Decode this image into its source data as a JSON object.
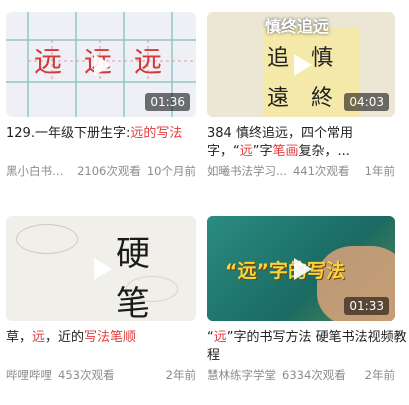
{
  "videos": [
    {
      "duration": "01:36",
      "title_parts": [
        "129.一年级下册生字:",
        "远的写法",
        "",
        ""
      ],
      "channel": "黑小白书法学...",
      "views": "2106次观看",
      "time": "10个月前",
      "thumb_chars": [
        "远",
        "远",
        "远"
      ]
    },
    {
      "duration": "04:03",
      "title_parts": [
        "384 慎终追远，四个常用字，“",
        "远",
        "”字",
        "笔画",
        "复杂，..."
      ],
      "channel": "如曦书法学习...",
      "views": "441次观看",
      "time": "1年前",
      "thumb_banner": "慎终追远",
      "thumb_chars": [
        "追",
        "慎",
        "遠",
        "終"
      ]
    },
    {
      "duration": "",
      "title_parts": [
        "草，",
        "远",
        "，近的",
        "写法笔顺"
      ],
      "channel": "哔哩哔哩",
      "views": "453次观看",
      "time": "2年前",
      "thumb_chars": [
        "硬",
        "笔"
      ]
    },
    {
      "duration": "01:33",
      "title_parts": [
        "“",
        "远",
        "”字的书写方法 硬笔书法视频教程"
      ],
      "channel": "慧林练字学堂",
      "views": "6334次观看",
      "time": "2年前",
      "thumb_banner": "“远”字的写法"
    }
  ],
  "colors": {
    "highlight": "#e03d3d",
    "meta": "#8c8c8c",
    "title": "#222222"
  }
}
